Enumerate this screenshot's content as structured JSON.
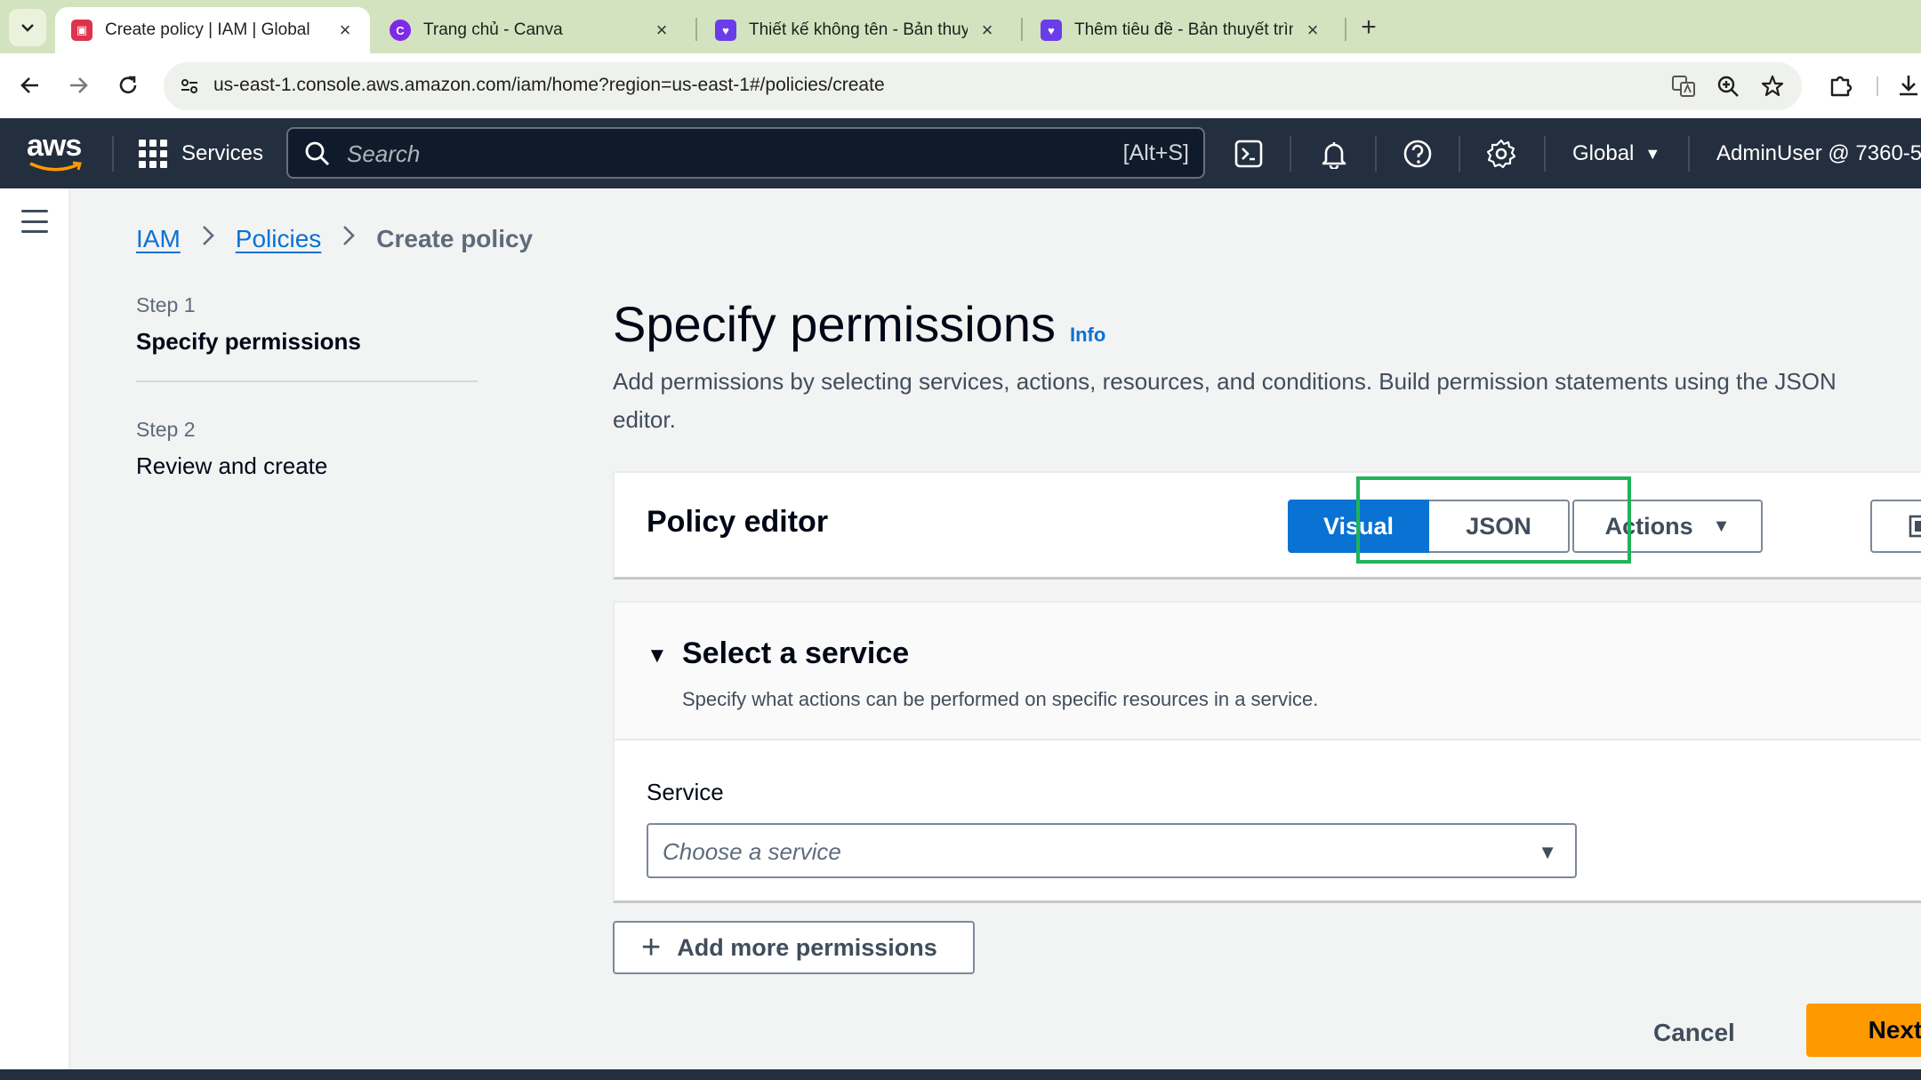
{
  "browser": {
    "tabs": [
      {
        "title": "Create policy | IAM | Global",
        "favicon_color": "#dd344c",
        "active": true
      },
      {
        "title": "Trang chủ - Canva",
        "favicon_color": "#7d2ae8",
        "active": false
      },
      {
        "title": "Thiết kế không tên - Bản thuyết",
        "favicon_color": "#6a3de8",
        "active": false
      },
      {
        "title": "Thêm tiêu đề - Bản thuyết trình",
        "favicon_color": "#6a3de8",
        "active": false
      }
    ],
    "close_glyph": "×",
    "new_tab_glyph": "+",
    "url": "us-east-1.console.aws.amazon.com/iam/home?region=us-east-1#/policies/create"
  },
  "aws_nav": {
    "logo_text": "aws",
    "services_label": "Services",
    "search_placeholder": "Search",
    "search_shortcut": "[Alt+S]",
    "region_label": "Global",
    "account_label": "AdminUser @ 7360-5"
  },
  "breadcrumb": {
    "items": [
      "IAM",
      "Policies",
      "Create policy"
    ]
  },
  "wizard": {
    "steps": [
      {
        "label": "Step 1",
        "title": "Specify permissions",
        "current": true
      },
      {
        "label": "Step 2",
        "title": "Review and create",
        "current": false
      }
    ]
  },
  "page": {
    "title": "Specify permissions",
    "info_link": "Info",
    "description": "Add permissions by selecting services, actions, resources, and conditions. Build permission statements using the JSON editor."
  },
  "policy_editor": {
    "title": "Policy editor",
    "modes": [
      "Visual",
      "JSON"
    ],
    "selected_mode": "Visual",
    "actions_label": "Actions"
  },
  "service_section": {
    "title": "Select a service",
    "subtitle": "Specify what actions can be performed on specific resources in a service.",
    "field_label": "Service",
    "placeholder": "Choose a service"
  },
  "footer": {
    "add_permissions_label": "Add more permissions",
    "cancel_label": "Cancel",
    "next_label": "Next"
  },
  "colors": {
    "primary_blue": "#0972d3",
    "aws_nav_bg": "#232f3e",
    "next_orange": "#ff9900",
    "highlight_green": "#1fb35a"
  }
}
